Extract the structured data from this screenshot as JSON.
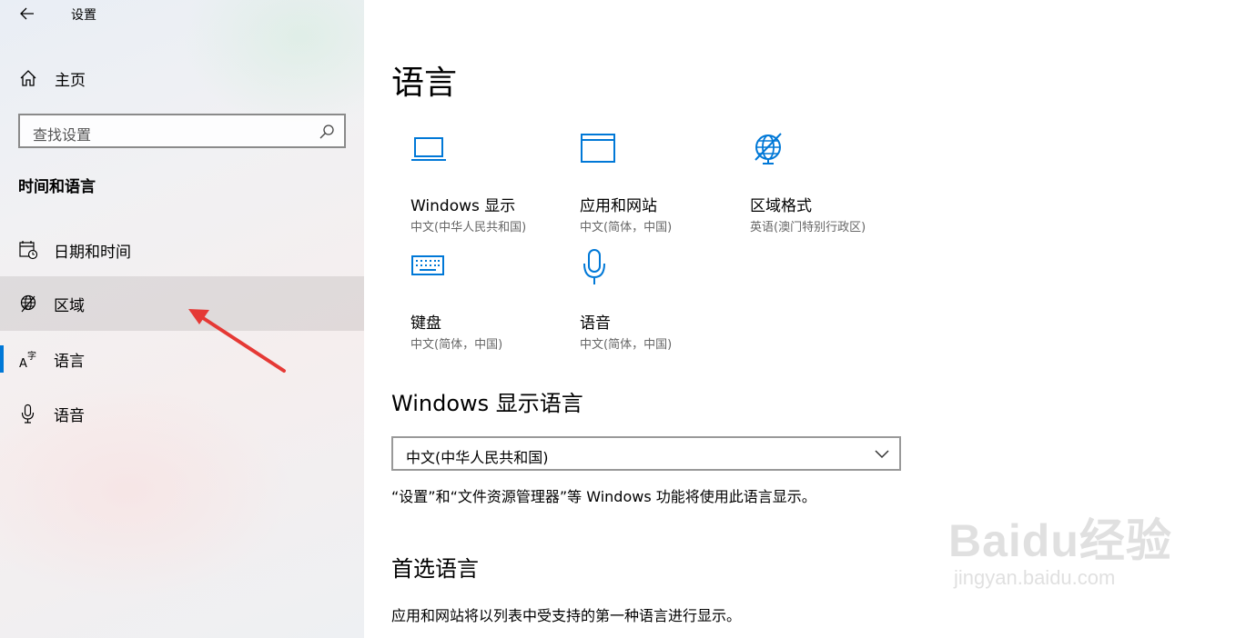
{
  "app": {
    "title": "设置"
  },
  "sidebar": {
    "home_label": "主页",
    "search_placeholder": "查找设置",
    "section_heading": "时间和语言",
    "items": [
      {
        "label": "日期和时间",
        "icon": "calendar-clock-icon"
      },
      {
        "label": "区域",
        "icon": "globe-region-icon"
      },
      {
        "label": "语言",
        "icon": "language-icon",
        "selected": true
      },
      {
        "label": "语音",
        "icon": "microphone-icon"
      }
    ]
  },
  "main": {
    "title": "语言",
    "tiles": [
      {
        "name": "Windows 显示",
        "sub": "中文(中华人民共和国)",
        "icon": "monitor-icon"
      },
      {
        "name": "应用和网站",
        "sub": "中文(简体，中国)",
        "icon": "window-icon"
      },
      {
        "name": "区域格式",
        "sub": "英语(澳门特别行政区)",
        "icon": "globe-icon"
      },
      {
        "name": "键盘",
        "sub": "中文(简体，中国)",
        "icon": "keyboard-icon"
      },
      {
        "name": "语音",
        "sub": "中文(简体，中国)",
        "icon": "microphone-icon"
      }
    ],
    "display_language": {
      "heading": "Windows 显示语言",
      "selected": "中文(中华人民共和国)",
      "description": "“设置”和“文件资源管理器”等 Windows 功能将使用此语言显示。"
    },
    "preferred": {
      "heading": "首选语言",
      "description": "应用和网站将以列表中受支持的第一种语言进行显示。"
    }
  },
  "watermark": {
    "brand": "Baidu经验",
    "url": "jingyan.baidu.com"
  },
  "colors": {
    "accent": "#0078d7",
    "annotation_arrow": "#e53935"
  }
}
